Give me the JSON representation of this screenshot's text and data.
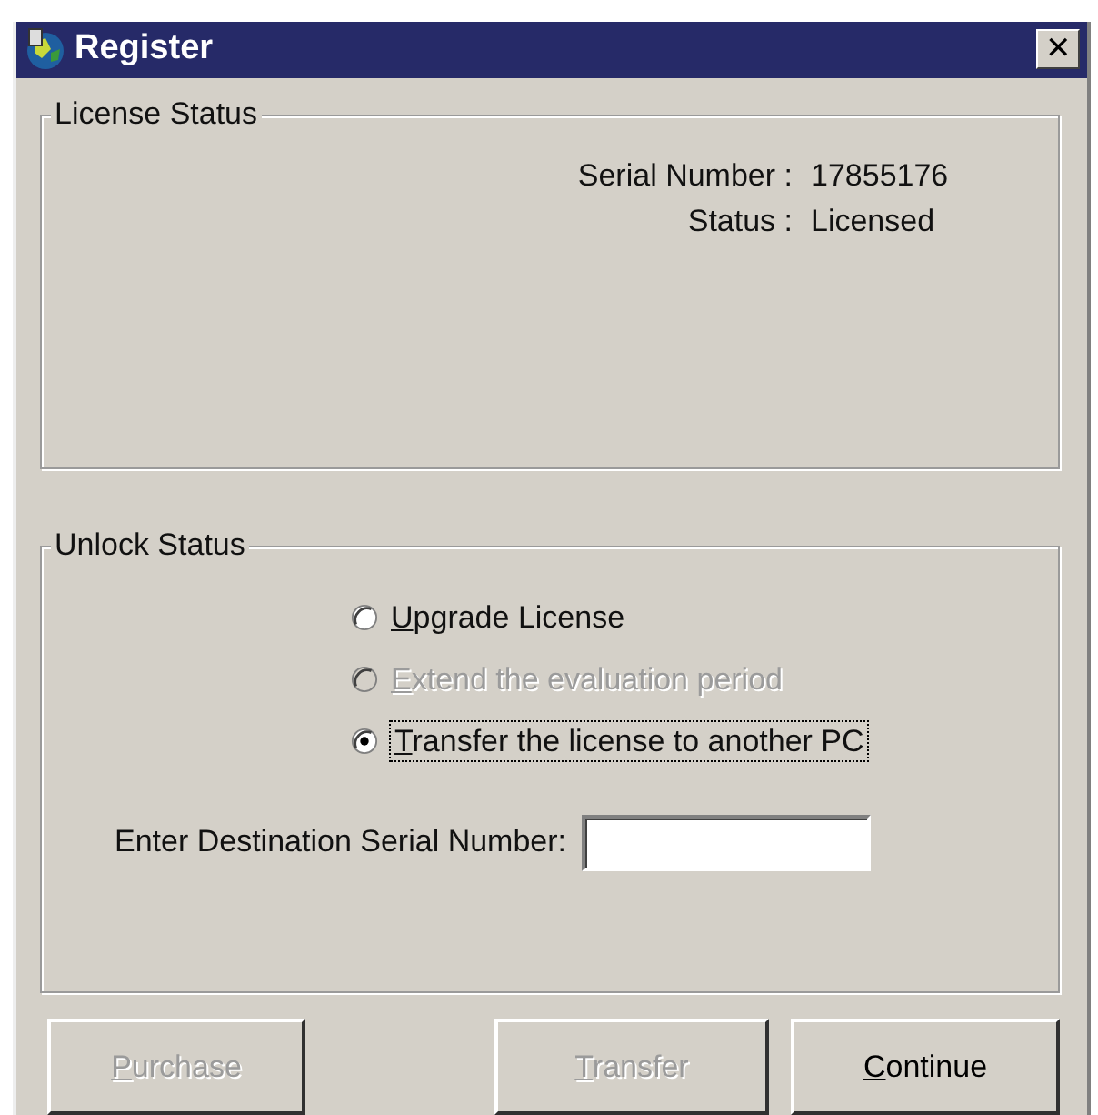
{
  "window": {
    "title": "Register",
    "close": "✕"
  },
  "license_status": {
    "title": "License Status",
    "fields": [
      {
        "label": "Serial Number :",
        "value": "17855176"
      },
      {
        "label": "Status :",
        "value": "Licensed"
      }
    ]
  },
  "unlock_status": {
    "title": "Unlock Status",
    "options": [
      {
        "label": "Upgrade License",
        "selected": false,
        "disabled": false,
        "focused": false,
        "mnemonic": true
      },
      {
        "label": "Extend the evaluation period",
        "selected": false,
        "disabled": true,
        "focused": false,
        "mnemonic": true
      },
      {
        "label": "Transfer the license to another PC",
        "selected": true,
        "disabled": false,
        "focused": true,
        "mnemonic": true
      }
    ],
    "destination": {
      "label": "Enter Destination Serial Number:"
    }
  },
  "buttons": [
    {
      "label": "Purchase",
      "disabled": true,
      "mnemonic": true
    },
    {
      "label": "Transfer",
      "disabled": true,
      "mnemonic": true
    },
    {
      "label": "Continue",
      "disabled": false,
      "mnemonic": true
    }
  ]
}
